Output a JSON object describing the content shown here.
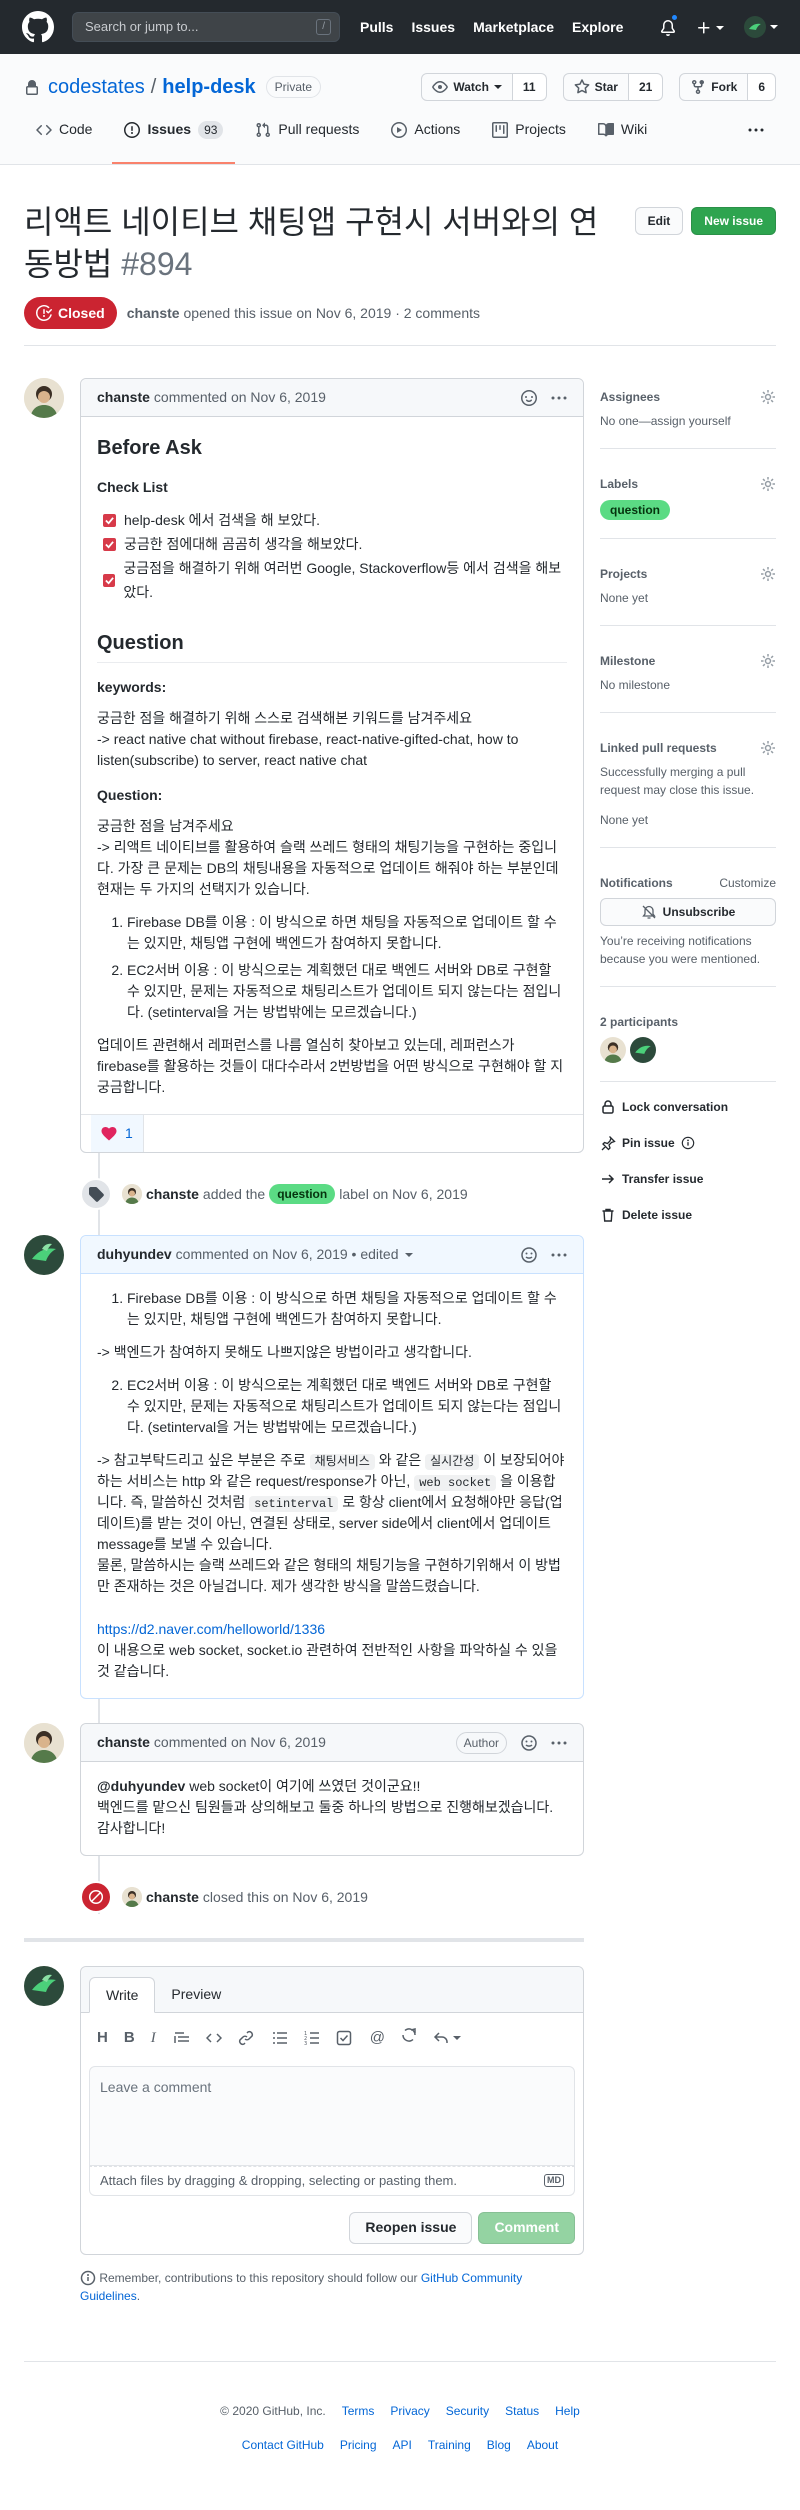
{
  "header": {
    "search_placeholder": "Search or jump to...",
    "slash": "/",
    "nav": [
      "Pulls",
      "Issues",
      "Marketplace",
      "Explore"
    ]
  },
  "repo": {
    "owner": "codestates",
    "sep": "/",
    "name": "help-desk",
    "visibility": "Private",
    "watch_label": "Watch",
    "watch_count": "11",
    "star_label": "Star",
    "star_count": "21",
    "fork_label": "Fork",
    "fork_count": "6",
    "tabs": [
      {
        "label": "Code"
      },
      {
        "label": "Issues",
        "count": "93"
      },
      {
        "label": "Pull requests"
      },
      {
        "label": "Actions"
      },
      {
        "label": "Projects"
      },
      {
        "label": "Wiki"
      }
    ]
  },
  "issue": {
    "title": "리액트 네이티브 채팅앱 구현시 서버와의 연동방법",
    "number": "#894",
    "edit_label": "Edit",
    "new_label": "New issue",
    "state": "Closed",
    "author": "chanste",
    "opened_text": "opened this issue on Nov 6, 2019 · 2 comments"
  },
  "comment1": {
    "author": "chanste",
    "date": "commented on Nov 6, 2019",
    "h_before": "Before Ask",
    "h_checklist": "Check List",
    "tasks": [
      "help-desk 에서 검색을 해 보았다.",
      "궁금한 점에대해 곰곰히 생각을 해보았다.",
      "궁금점을 해결하기 위해 여러번 Google, Stackoverflow등 에서 검색을 해보았다."
    ],
    "h_question": "Question",
    "h_keywords": "keywords:",
    "keywords_line1": "궁금한 점을 해결하기 위해 스스로 검색해본 키워드를 남겨주세요",
    "keywords_line2": "-> react native chat without firebase, react-native-gifted-chat, how to listen(subscribe) to server, react native chat",
    "h_q": "Question:",
    "q_line1": "궁금한 점을 남겨주세요",
    "q_line2": "-> 리액트 네이티브를 활용하여 슬랙 쓰레드 형태의 채팅기능을 구현하는 중입니다. 가장 큰 문제는 DB의 채팅내용을 자동적으로 업데이트 해줘야 하는 부분인데 현재는 두 가지의 선택지가 있습니다.",
    "options": [
      "Firebase DB를 이용 : 이 방식으로 하면 채팅을 자동적으로 업데이트 할 수는 있지만, 채팅앱 구현에 백엔드가 참여하지 못합니다.",
      "EC2서버 이용 : 이 방식으로는 계획했던 대로 백엔드 서버와 DB로 구현할 수 있지만, 문제는 자동적으로 채팅리스트가 업데이트 되지 않는다는 점입니다. (setinterval을 거는 방법밖에는 모르겠습니다.)"
    ],
    "closing": "업데이트 관련해서 레퍼런스를 나름 열심히 찾아보고 있는데, 레퍼런스가 firebase를 활용하는 것들이 대다수라서 2번방법을 어떤 방식으로 구현해야 할 지 궁금합니다.",
    "reaction_count": "1"
  },
  "event_label": {
    "actor": "chanste",
    "pre": "added the",
    "label": "question",
    "post": "label on Nov 6, 2019"
  },
  "comment2": {
    "author": "duhyundev",
    "date": "commented on Nov 6, 2019 • edited",
    "item1": "Firebase DB를 이용 : 이 방식으로 하면 채팅을 자동적으로 업데이트 할 수는 있지만, 채팅앱 구현에 백엔드가 참여하지 못합니다.",
    "note1": "-> 백엔드가 참여하지 못해도 나쁘지않은 방법이라고 생각합니다.",
    "item2": "EC2서버 이용 : 이 방식으로는 계획했던 대로 백엔드 서버와 DB로 구현할 수 있지만, 문제는 자동적으로 채팅리스트가 업데이트 되지 않는다는 점입니다. (setinterval을 거는 방법밖에는 모르겠습니다.)",
    "p_a": "-> 참고부탁드리고 싶은 부분은 주로",
    "code1": "채팅서비스",
    "p_b": "와 같은",
    "code2": "실시간성",
    "p_c": "이 보장되어야하는 서비스는 http 와 같은 request/response가 아닌,",
    "code3": "web socket",
    "p_d": "을 이용합니다. 즉, 말씀하신 것처럼",
    "code4": "setinterval",
    "p_e": "로 항상 client에서 요청해야만 응답(업데이트)를 받는 것이 아닌, 연결된 상태로, server side에서 client에서 업데이트 message를 보낼 수 있습니다.",
    "p_f": "물론, 말씀하시는 슬랙 쓰레드와 같은 형태의 채팅기능을 구현하기위해서 이 방법만 존재하는 것은 아닐겁니다. 제가 생각한 방식을 말씀드렸습니다.",
    "link": "https://d2.naver.com/helloworld/1336",
    "p_g": "이 내용으로 web socket, socket.io 관련하여 전반적인 사항을 파악하실 수 있을 것 같습니다."
  },
  "comment3": {
    "author": "chanste",
    "date": "commented on Nov 6, 2019",
    "badge": "Author",
    "mention": "@duhyundev",
    "line1": "web socket이 여기에 쓰였던 것이군요!!",
    "line2": "백엔드를 맡으신 팀원들과 상의해보고 둘중 하나의 방법으로 진행해보겠습니다. 감사합니다!"
  },
  "event_closed": {
    "actor": "chanste",
    "text": "closed this on Nov 6, 2019"
  },
  "form": {
    "tab_write": "Write",
    "tab_preview": "Preview",
    "placeholder": "Leave a comment",
    "attach": "Attach files by dragging & dropping, selecting or pasting them.",
    "md": "MD",
    "reopen": "Reopen issue",
    "submit": "Comment",
    "tip_pre": "Remember, contributions to this repository should follow our",
    "tip_link": "GitHub Community Guidelines",
    "tip_post": "."
  },
  "sidebar": {
    "assignees_h": "Assignees",
    "assignees_v": "No one—assign yourself",
    "labels_h": "Labels",
    "label": "question",
    "projects_h": "Projects",
    "projects_v": "None yet",
    "milestone_h": "Milestone",
    "milestone_v": "No milestone",
    "linked_h": "Linked pull requests",
    "linked_desc": "Successfully merging a pull request may close this issue.",
    "linked_v": "None yet",
    "notif_h": "Notifications",
    "customize": "Customize",
    "unsub": "Unsubscribe",
    "notif_desc": "You’re receiving notifications because you were mentioned.",
    "participants_h": "2 participants",
    "lock": "Lock conversation",
    "pin": "Pin issue",
    "transfer": "Transfer issue",
    "delete": "Delete issue"
  },
  "footer": {
    "copyright": "© 2020 GitHub, Inc.",
    "row1": [
      "Terms",
      "Privacy",
      "Security",
      "Status",
      "Help"
    ],
    "row2": [
      "Contact GitHub",
      "Pricing",
      "API",
      "Training",
      "Blog",
      "About"
    ]
  },
  "colors": {
    "header_bg": "#24292e",
    "closed": "#cb2431",
    "label": "#5bdb84",
    "link": "#0366d6",
    "tab_underline": "#f9826c",
    "green": "#2ea44f"
  }
}
